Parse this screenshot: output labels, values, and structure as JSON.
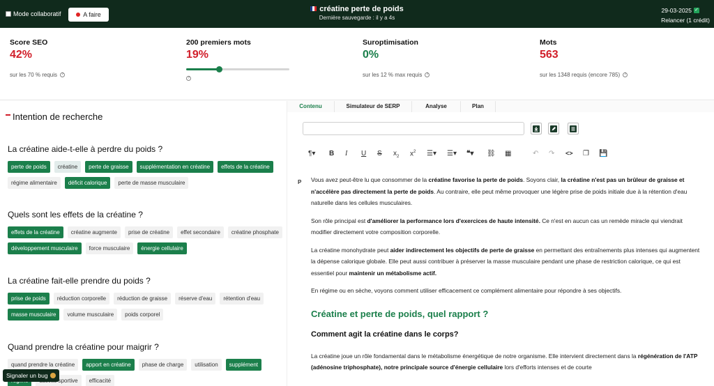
{
  "topbar": {
    "collab_label": "Mode collaboratif",
    "status_label": "A faire",
    "title": "créatine perte de poids",
    "save_status": "Dernière sauvegarde : il y a 4s",
    "date": "29-03-2025",
    "relaunch": "Relancer (1 crédit)",
    "status_color": "#e02424"
  },
  "metrics": {
    "seo": {
      "label": "Score SEO",
      "value": "42%",
      "sub": "sur les 70 % requis"
    },
    "first200": {
      "label": "200 premiers mots",
      "value": "19%",
      "slider_value": 0.32
    },
    "overopt": {
      "label": "Suroptimisation",
      "value": "0%",
      "sub": "sur les 12 % max requis"
    },
    "words": {
      "label": "Mots",
      "value": "563",
      "sub": "sur les 1348 requis (encore 785)"
    }
  },
  "intent": {
    "heading": "Intention de recherche",
    "questions": [
      {
        "q": "La créatine aide-t-elle à perdre du poids ?",
        "tags": [
          "perte de poids",
          "créatine",
          "perte de graisse",
          "supplémentation en créatine",
          "effets de la créatine",
          "régime alimentaire",
          "déficit calorique",
          "perte de masse musculaire"
        ]
      },
      {
        "q": "Quels sont les effets de la créatine ?",
        "tags": [
          "effets de la créatine",
          "créatine augmente",
          "prise de créatine",
          "effet secondaire",
          "créatine phosphate",
          "développement musculaire",
          "force musculaire",
          "énergie cellulaire"
        ]
      },
      {
        "q": "La créatine fait-elle prendre du poids ?",
        "tags": [
          "prise de poids",
          "réduction corporelle",
          "réduction de graisse",
          "réserve d'eau",
          "rétention d'eau",
          "masse musculaire",
          "volume musculaire",
          "poids corporel"
        ]
      },
      {
        "q": "Quand prendre la créatine pour maigrir ?",
        "tags": [
          "quand prendre la créatine",
          "apport en créatine",
          "phase de charge",
          "utilisation",
          "supplément",
          "régime",
          "activité sportive",
          "efficacité"
        ]
      }
    ]
  },
  "bug_button": "Signaler un bug",
  "tabs": [
    "Contenu",
    "Simulateur de SERP",
    "Analyse",
    "Plan"
  ],
  "editor": {
    "url_value": "",
    "para_marker": "P",
    "p1_a": "Vous avez peut-être lu que consommer de la ",
    "p1_b": "créatine favorise la perte de poids",
    "p1_c": ". Soyons clair, ",
    "p1_d": "la créatine n'est pas un brûleur de graisse et n'accélère pas directement la perte de poids",
    "p1_e": ". Au contraire, elle peut même provoquer une légère prise de poids initiale due à la rétention d'eau naturelle dans les cellules musculaires.",
    "p2_a": "Son rôle principal est ",
    "p2_b": "d'améliorer la performance lors d'exercices de haute intensité.",
    "p2_c": " Ce n'est en aucun cas un remède miracle qui viendrait modifier directement votre composition corporelle.",
    "p3_a": "La créatine monohydrate peut ",
    "p3_b": "aider indirectement les objectifs de perte de graisse",
    "p3_c": " en permettant des entraînements plus intenses qui augmentent la dépense calorique globale. Elle peut aussi contribuer à préserver la masse musculaire pendant une phase de restriction calorique, ce qui est essentiel pour ",
    "p3_d": "maintenir un métabolisme actif.",
    "p4": "En régime ou en sèche, voyons comment utiliser efficacement ce complément alimentaire pour répondre à ses objectifs.",
    "h2": "Créatine et perte de poids, quel rapport ?",
    "h3": "Comment agit la créatine dans le corps?",
    "p5_a": "La créatine joue un rôle fondamental dans le métabolisme énergétique de notre organisme. Elle intervient directement dans la ",
    "p5_b": "régénération  de l'ATP (adénosine triphosphate), notre principale source d'énergie cellulaire",
    "p5_c": " lors d'efforts intenses et de courte"
  },
  "colors": {
    "brand_dark": "#102a1c",
    "accent_green": "#1b7f4b",
    "alert_red": "#d11f2a"
  }
}
